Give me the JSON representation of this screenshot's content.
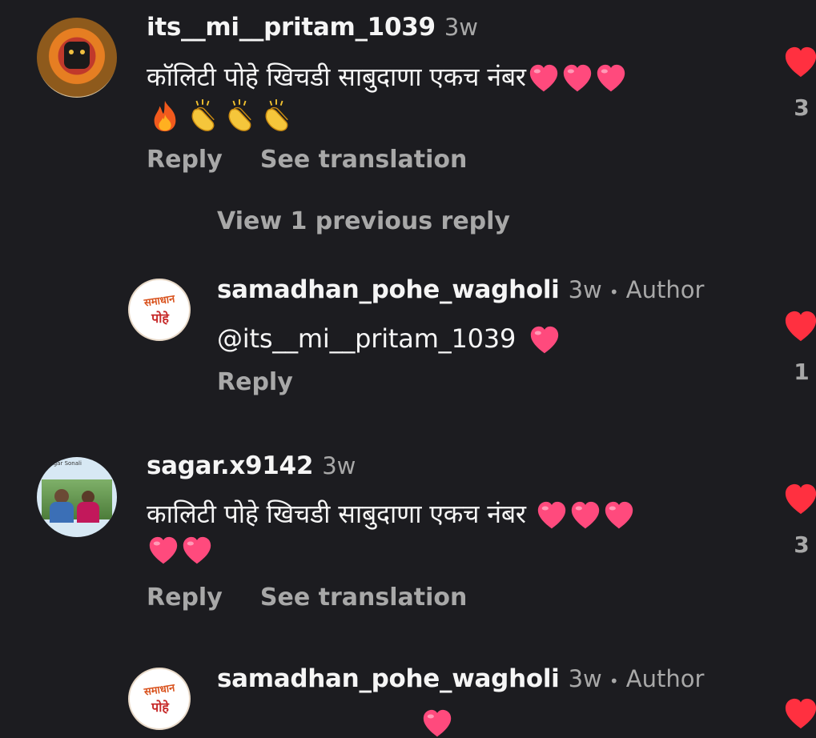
{
  "colors": {
    "background": "#1c1c20",
    "heart": "#ff3040",
    "emoji_heart": "#ff4a7d",
    "muted": "#a8a8a8"
  },
  "comments": [
    {
      "username": "its__mi__pritam_1039",
      "time": "3w",
      "text_line1": "कॉलिटी पोहे खिचडी साबुदाणा एकच नंबर",
      "actions": {
        "reply": "Reply",
        "translate": "See translation"
      },
      "likes": "3",
      "view_replies": "View 1 previous reply",
      "reply": {
        "username": "samadhan_pohe_wagholi",
        "time": "3w",
        "separator": "•",
        "badge": "Author",
        "mention": "@its__mi__pritam_1039",
        "actions": {
          "reply": "Reply"
        },
        "likes": "1",
        "logo_text_top": "समाधान",
        "logo_text_bottom": "पोहे"
      }
    },
    {
      "username": "sagar.x9142",
      "time": "3w",
      "text_line1": "कालिटी पोहे खिचडी साबुदाणा एकच नंबर",
      "actions": {
        "reply": "Reply",
        "translate": "See translation"
      },
      "likes": "3",
      "avatar_caption": "Sagar Sonali",
      "reply": {
        "username": "samadhan_pohe_wagholi",
        "time": "3w",
        "separator": "•",
        "badge": "Author",
        "logo_text_top": "समाधान",
        "logo_text_bottom": "पोहे"
      }
    }
  ]
}
